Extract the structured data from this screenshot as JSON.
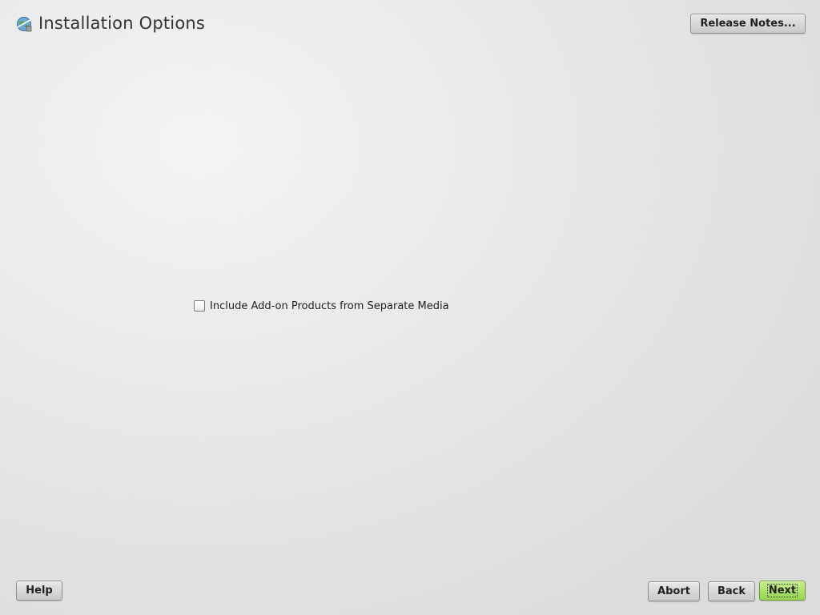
{
  "header": {
    "title": "Installation Options",
    "icon": "installer-globe-icon",
    "release_notes_label": "Release Notes..."
  },
  "main": {
    "addon_checkbox": {
      "label": "Include Add-on Products from Separate Media",
      "checked": false
    }
  },
  "footer": {
    "help_label": "Help",
    "abort_label": "Abort",
    "back_label": "Back",
    "next_label": "Next"
  },
  "colors": {
    "next_button": "#a6dc62",
    "background": "#e6e6e6"
  }
}
